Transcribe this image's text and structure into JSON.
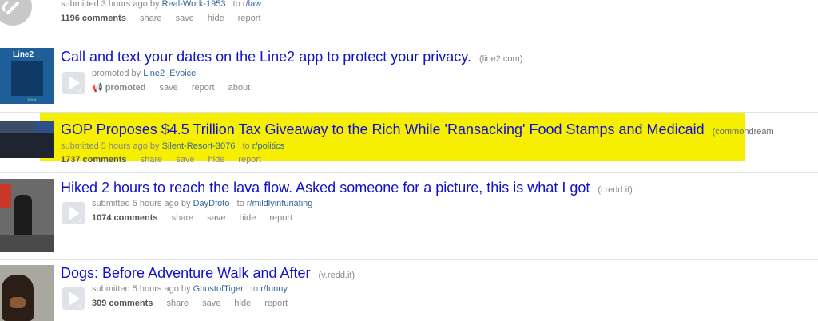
{
  "posts": [
    {
      "tagline_prefix": "submitted 3 hours ago by",
      "author": "Real-Work-1953",
      "to": "to",
      "subreddit": "r/law",
      "comments": "1196 comments",
      "share": "share",
      "save": "save",
      "hide": "hide",
      "report": "report"
    },
    {
      "title": "Call and text your dates on the Line2 app to protect your privacy.",
      "domain": "(line2.com)",
      "tagline_prefix": "promoted by",
      "author": "Line2_Evoice",
      "promoted": "promoted",
      "save": "save",
      "report": "report",
      "about": "about",
      "thumb_text": "Line2"
    },
    {
      "title": "GOP Proposes $4.5 Trillion Tax Giveaway to the Rich While 'Ransacking' Food Stamps and Medicaid",
      "domain": "(commondream",
      "tagline_prefix": "submitted 5 hours ago by",
      "author": "Silent-Resort-3076",
      "to": "to",
      "subreddit": "r/politics",
      "comments": "1737 comments",
      "share": "share",
      "save": "save",
      "hide": "hide",
      "report": "report",
      "highlight_color": "#f7ef00"
    },
    {
      "title": "Hiked 2 hours to reach the lava flow. Asked someone for a picture, this is what I got",
      "domain": "(i.redd.it)",
      "tagline_prefix": "submitted 5 hours ago by",
      "author": "DayDfoto",
      "to": "to",
      "subreddit": "r/mildlyinfuriating",
      "comments": "1074 comments",
      "share": "share",
      "save": "save",
      "hide": "hide",
      "report": "report"
    },
    {
      "title": "Dogs: Before Adventure Walk and After",
      "domain": "(v.redd.it)",
      "tagline_prefix": "submitted 5 hours ago by",
      "author": "GhostofTiger",
      "to": "to",
      "subreddit": "r/funny",
      "comments": "309 comments",
      "share": "share",
      "save": "save",
      "hide": "hide",
      "report": "report"
    }
  ],
  "colors": {
    "title_link": "#1111cc",
    "meta_link": "#336699",
    "highlight": "#f7ef00"
  }
}
